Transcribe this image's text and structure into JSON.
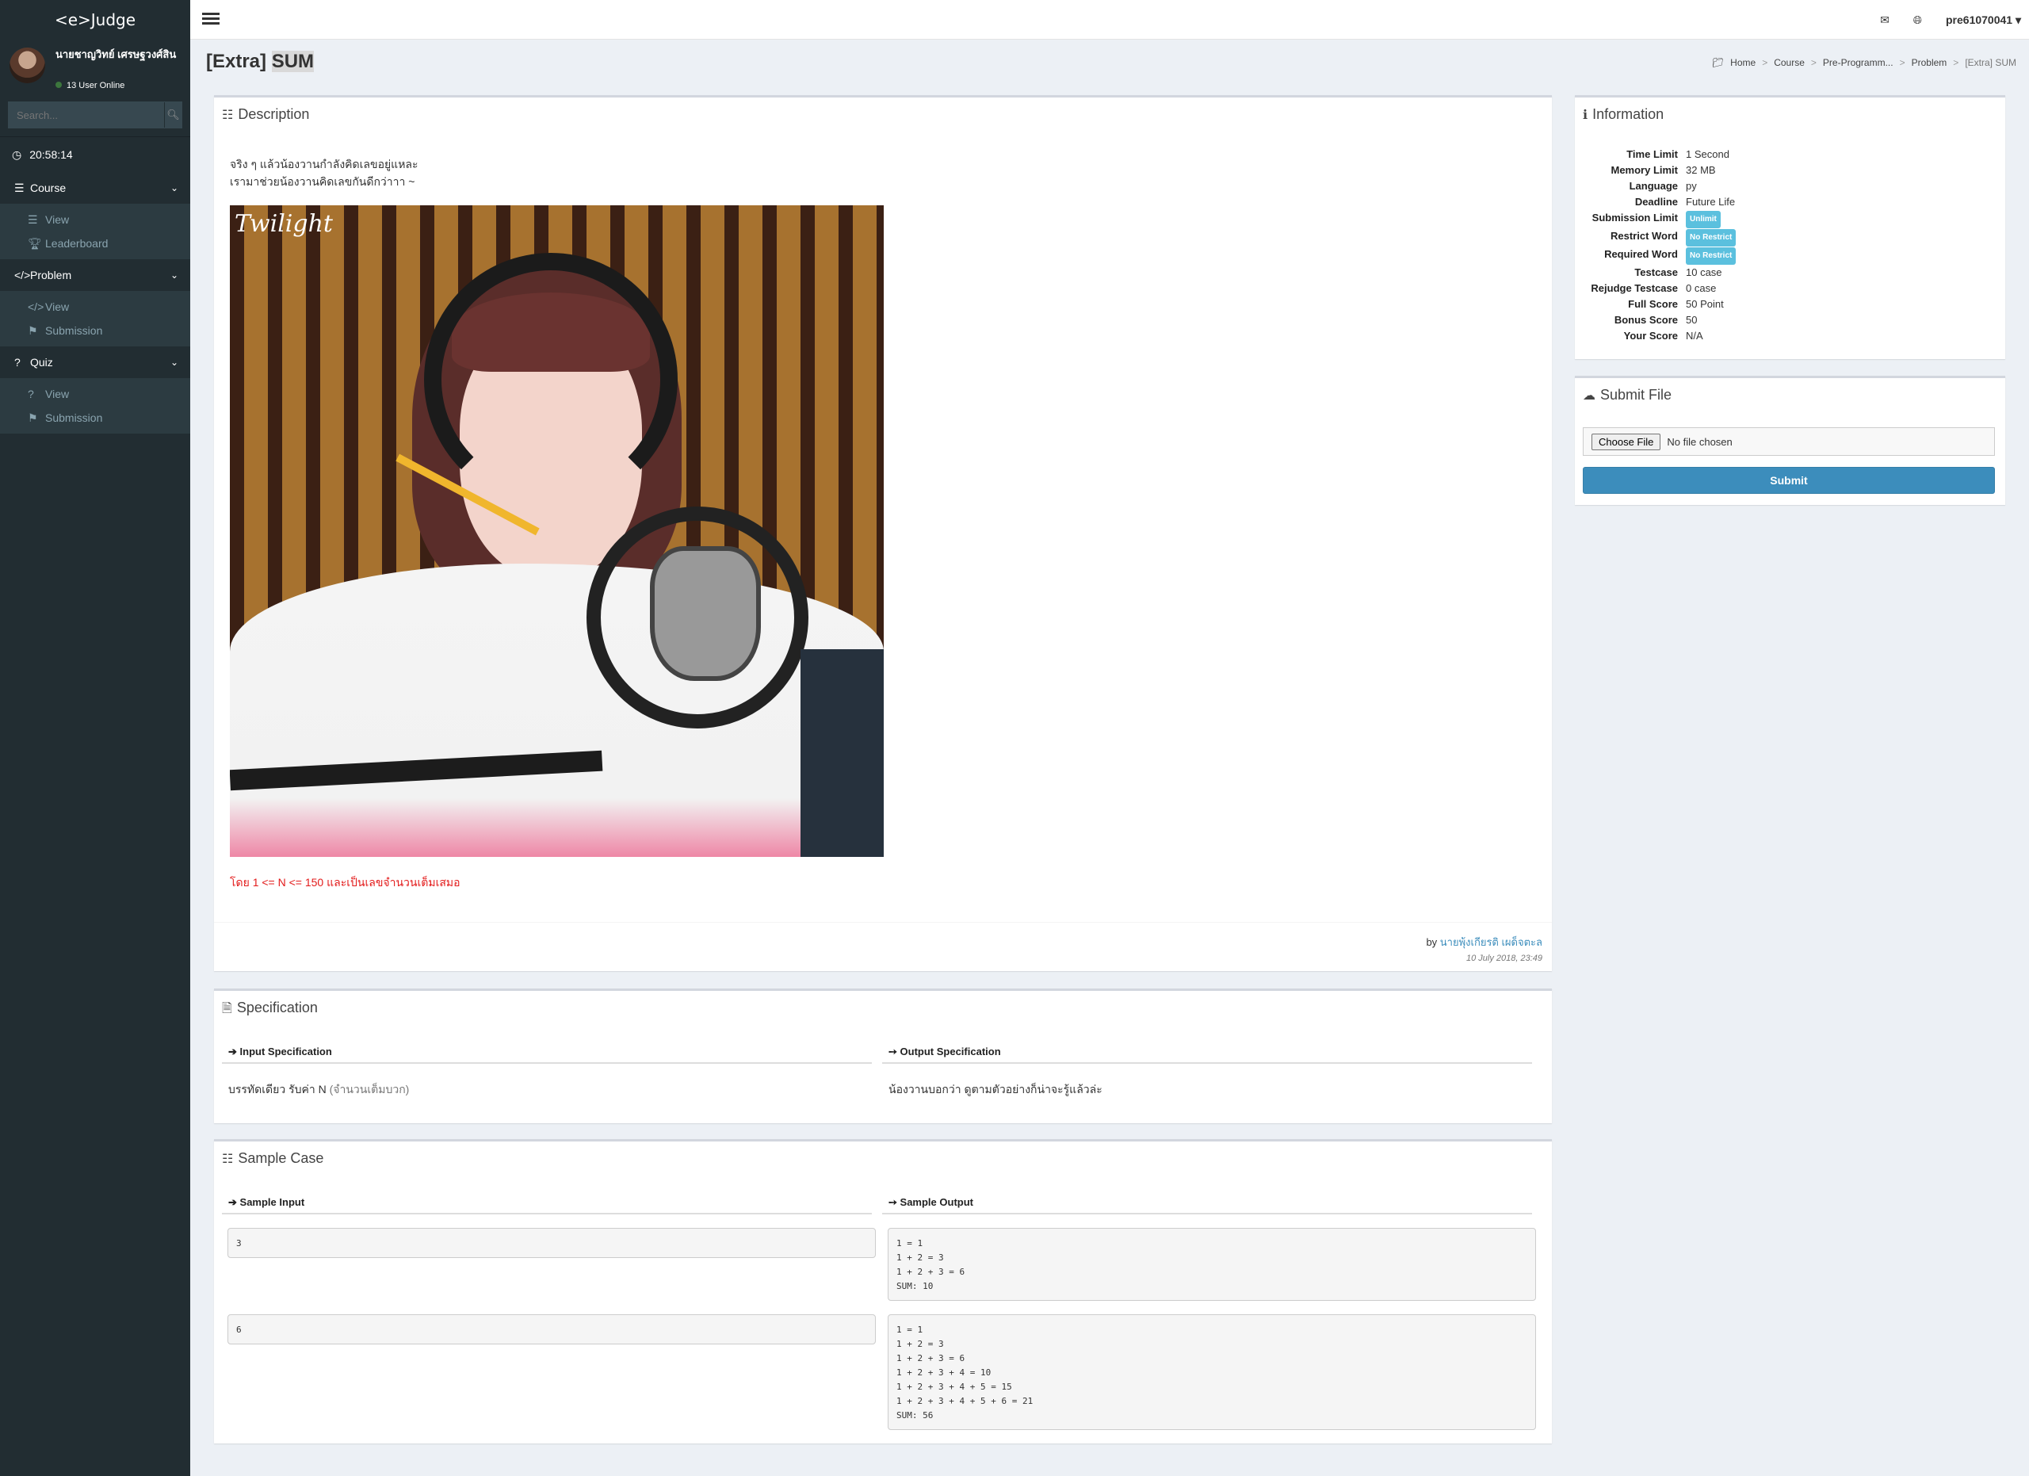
{
  "app": {
    "logo": "<e>Judge"
  },
  "user_panel": {
    "name": "นายชาญวิทย์ เศรษฐวงศ์สิน",
    "online": "13 User Online"
  },
  "search": {
    "placeholder": "Search..."
  },
  "clock": "20:58:14",
  "sidebar": {
    "sections": [
      {
        "label": "Course",
        "items": [
          "View",
          "Leaderboard"
        ]
      },
      {
        "label": "Problem",
        "items": [
          "View",
          "Submission"
        ]
      },
      {
        "label": "Quiz",
        "items": [
          "View",
          "Submission"
        ]
      }
    ]
  },
  "topbar": {
    "username": "pre61070041"
  },
  "page": {
    "title_prefix": "[Extra]",
    "title_main": "SUM",
    "breadcrumb": [
      "Home",
      "Course",
      "Pre-Programm...",
      "Problem",
      "[Extra] SUM"
    ]
  },
  "description": {
    "title": "Description",
    "line1": "จริง ๆ แล้วน้องวานกำลังคิดเลขอยู่แหละ",
    "line2": "เรามาช่วยน้องวานคิดเลขกันดีกว่าาา ~",
    "image_watermark": "Twilight",
    "constraint": "โดย 1 <= N <= 150  และเป็นเลขจำนวนเต็มเสมอ",
    "author_prefix": "by",
    "author": "นายพุ้งเกียรติ เผด็จตะล",
    "date": "10 July 2018, 23:49"
  },
  "specification": {
    "title": "Specification",
    "input_head": "Input Specification",
    "output_head": "Output Specification",
    "input_text": "บรรทัดเดียว รับค่า N",
    "input_note": "(จำนวนเต็มบวก)",
    "output_text": "น้องวานบอกว่า ดูตามตัวอย่างก็น่าจะรู้แล้วล่ะ"
  },
  "sample": {
    "title": "Sample Case",
    "input_head": "Sample Input",
    "output_head": "Sample Output",
    "cases": [
      {
        "input": "3",
        "output": "1 = 1\n1 + 2 = 3\n1 + 2 + 3 = 6\nSUM: 10"
      },
      {
        "input": "6",
        "output": "1 = 1\n1 + 2 = 3\n1 + 2 + 3 = 6\n1 + 2 + 3 + 4 = 10\n1 + 2 + 3 + 4 + 5 = 15\n1 + 2 + 3 + 4 + 5 + 6 = 21\nSUM: 56"
      }
    ]
  },
  "information": {
    "title": "Information",
    "rows": [
      {
        "k": "Time Limit",
        "v": "1 Second"
      },
      {
        "k": "Memory Limit",
        "v": "32 MB"
      },
      {
        "k": "Language",
        "v": "py"
      },
      {
        "k": "Deadline",
        "v": "Future Life"
      },
      {
        "k": "Submission Limit",
        "badge": "Unlimit"
      },
      {
        "k": "Restrict Word",
        "badge": "No Restrict"
      },
      {
        "k": "Required Word",
        "badge": "No Restrict"
      },
      {
        "k": "Testcase",
        "v": "10 case"
      },
      {
        "k": "Rejudge Testcase",
        "v": "0 case"
      },
      {
        "k": "Full Score",
        "v": "50 Point"
      },
      {
        "k": "Bonus Score",
        "v": "50"
      },
      {
        "k": "Your Score",
        "v": "N/A"
      }
    ]
  },
  "submit_file": {
    "title": "Submit File",
    "choose_label": "Choose File",
    "no_file": "No file chosen",
    "submit_label": "Submit"
  },
  "colors": {
    "accent": "#3c8dbc",
    "sidebar": "#222d32",
    "badge": "#5bc0de",
    "danger": "#e31b1b"
  }
}
